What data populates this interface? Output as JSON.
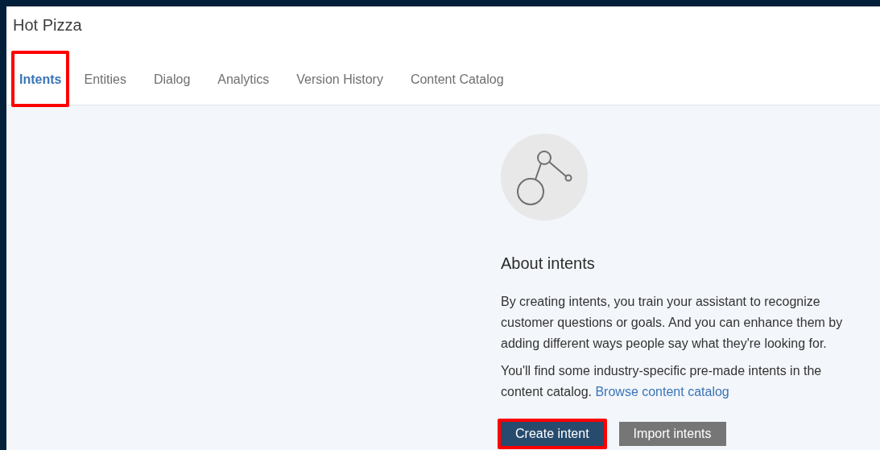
{
  "app": {
    "title": "Hot Pizza"
  },
  "tabs": [
    {
      "label": "Intents",
      "selected": true,
      "highlighted": true
    },
    {
      "label": "Entities",
      "selected": false,
      "highlighted": false
    },
    {
      "label": "Dialog",
      "selected": false,
      "highlighted": false
    },
    {
      "label": "Analytics",
      "selected": false,
      "highlighted": false
    },
    {
      "label": "Version History",
      "selected": false,
      "highlighted": false
    },
    {
      "label": "Content Catalog",
      "selected": false,
      "highlighted": false
    }
  ],
  "empty_state": {
    "heading": "About intents",
    "paragraphs": [
      {
        "text": "By creating intents, you train your assistant to recognize customer questions or goals. And you can enhance them by adding different ways people say what they're looking for."
      },
      {
        "text": "You'll find some industry-specific pre-made intents in the content catalog.",
        "link": "Browse content catalog"
      }
    ],
    "buttons": [
      {
        "label": "Create intent",
        "kind": "primary",
        "highlighted": true
      },
      {
        "label": "Import intents",
        "kind": "secondary",
        "highlighted": false
      }
    ]
  }
}
